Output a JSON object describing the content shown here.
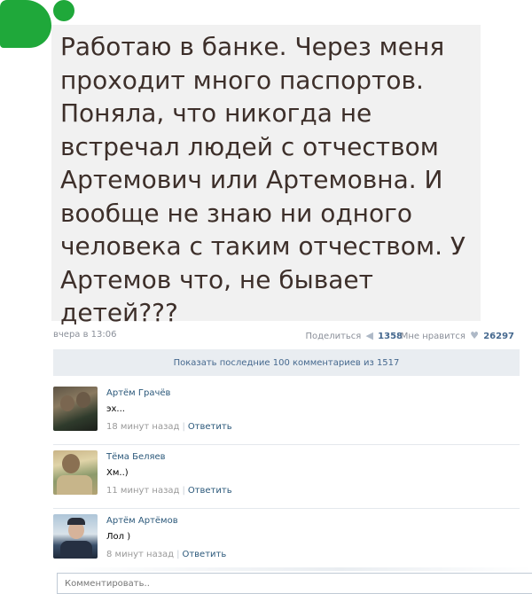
{
  "post": {
    "text": "Работаю в банке. Через меня проходит много паспортов. Поняла, что никогда не встречал людей с отчеством Артемович или Артемовна. И вообще не знаю ни одного человека с таким отчеством. У Артемов что, не бывает детей???",
    "date": "вчера в 13:06",
    "share_label": "Поделиться",
    "share_count": "1358",
    "like_label": "Мне нравится",
    "like_count": "26297"
  },
  "show_comments_label": "Показать последние 100 комментариев из 1517",
  "comments": [
    {
      "author": "Артём Грачёв",
      "text": "эх...",
      "time": "18 минут назад",
      "reply": "Ответить"
    },
    {
      "author": "Тёма Беляев",
      "text": "Хм..)",
      "time": "11 минут назад",
      "reply": "Ответить"
    },
    {
      "author": "Артём Артёмов",
      "text": "Лол )",
      "time": "8 минут назад",
      "reply": "Ответить"
    }
  ],
  "comment_placeholder": "Комментировать..",
  "colors": {
    "link": "#2b587a",
    "accent": "#45688e",
    "post_bg": "#f1f1f1",
    "blot": "#1fa83a"
  },
  "icons": {
    "share": "megaphone-icon",
    "like": "heart-icon"
  }
}
